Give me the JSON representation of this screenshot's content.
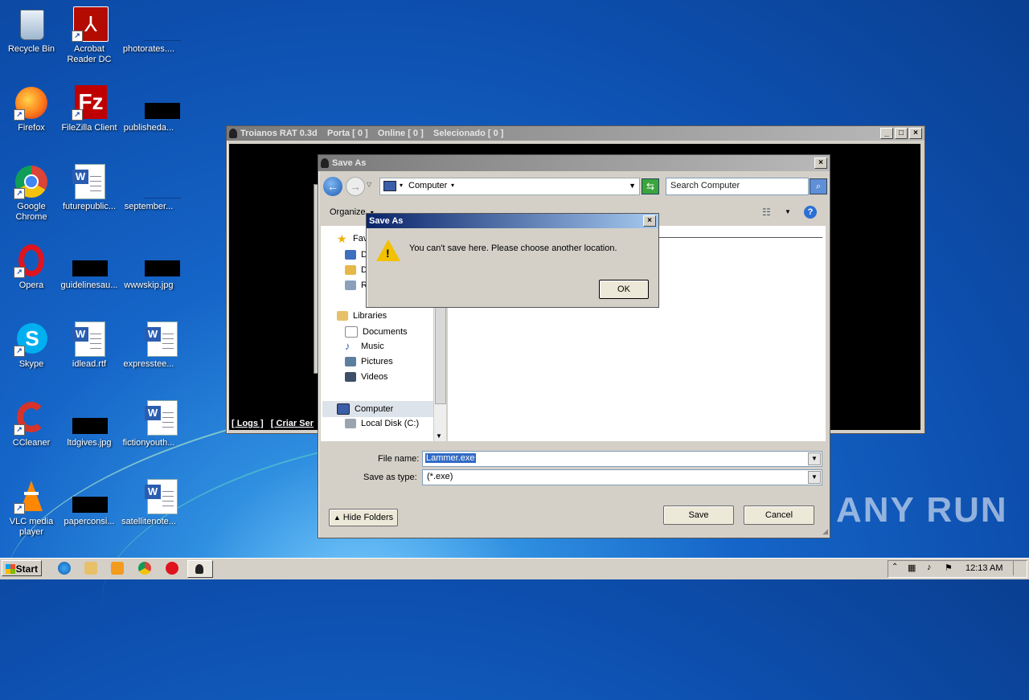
{
  "desktop": {
    "icons": [
      {
        "label": "Recycle Bin"
      },
      {
        "label": "Acrobat Reader DC"
      },
      {
        "label": "photorates...."
      },
      {
        "label": "Firefox"
      },
      {
        "label": "FileZilla Client"
      },
      {
        "label": "publisheda..."
      },
      {
        "label": "Google Chrome"
      },
      {
        "label": "futurepublic..."
      },
      {
        "label": "september..."
      },
      {
        "label": "Opera"
      },
      {
        "label": "guidelinesau..."
      },
      {
        "label": "wwwskip.jpg"
      },
      {
        "label": "Skype"
      },
      {
        "label": "idlead.rtf"
      },
      {
        "label": "expresstee..."
      },
      {
        "label": "CCleaner"
      },
      {
        "label": "ltdgives.jpg"
      },
      {
        "label": "fictionyouth..."
      },
      {
        "label": "VLC media player"
      },
      {
        "label": "paperconsi..."
      },
      {
        "label": "satellitenote..."
      }
    ]
  },
  "rat_window": {
    "title": "Troianos RAT 0.3d    Porta [ 0 ]    Online [ 0 ]    Selecionado [ 0 ]",
    "links": [
      "[ Logs ]",
      "[ Criar Ser"
    ]
  },
  "save_dialog": {
    "title": "Save As",
    "address": "Computer",
    "search_placeholder": "Search Computer",
    "organize_label": "Organize",
    "nav": {
      "favorites_label": "Fav",
      "fav_items": [
        "D",
        "D",
        "R"
      ],
      "libraries_label": "Libraries",
      "libraries": [
        "Documents",
        "Music",
        "Pictures",
        "Videos"
      ],
      "computer_label": "Computer",
      "drives": [
        "Local Disk (C:)"
      ]
    },
    "file_name_label": "File name:",
    "file_name_value": "Lammer.exe",
    "save_type_label": "Save as type:",
    "save_type_value": "(*.exe)",
    "hide_folders_label": "Hide Folders",
    "save_label": "Save",
    "cancel_label": "Cancel"
  },
  "alert": {
    "title": "Save As",
    "message": "You can't save here. Please choose another location.",
    "ok_label": "OK"
  },
  "taskbar": {
    "start_label": "Start",
    "clock": "12:13 AM"
  },
  "watermark": "ANY RUN",
  "colors": {
    "title_active": "#0a246a",
    "title_inactive": "#7a7a7a",
    "selection": "#316ac5"
  }
}
